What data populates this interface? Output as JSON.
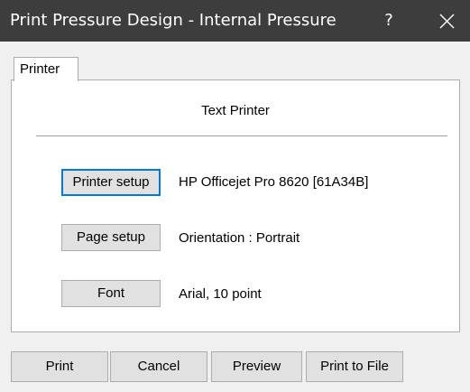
{
  "window": {
    "title": "Print Pressure Design - Internal Pressure",
    "help_glyph": "?",
    "close_icon": "close-icon"
  },
  "tabs": [
    {
      "label": "Printer",
      "active": true
    }
  ],
  "panel": {
    "heading": "Text Printer",
    "rows": [
      {
        "button_label": "Printer setup",
        "value": "HP Officejet Pro 8620 [61A34B]"
      },
      {
        "button_label": "Page setup",
        "value": "Orientation : Portrait"
      },
      {
        "button_label": "Font",
        "value": "Arial, 10 point"
      }
    ]
  },
  "footer": {
    "print_label": "Print",
    "cancel_label": "Cancel",
    "preview_label": "Preview",
    "print_to_file_label": "Print to File"
  },
  "colors": {
    "titlebar": "#3d3d3d",
    "focus_border": "#0078d7",
    "button_face": "#e1e1e1"
  }
}
